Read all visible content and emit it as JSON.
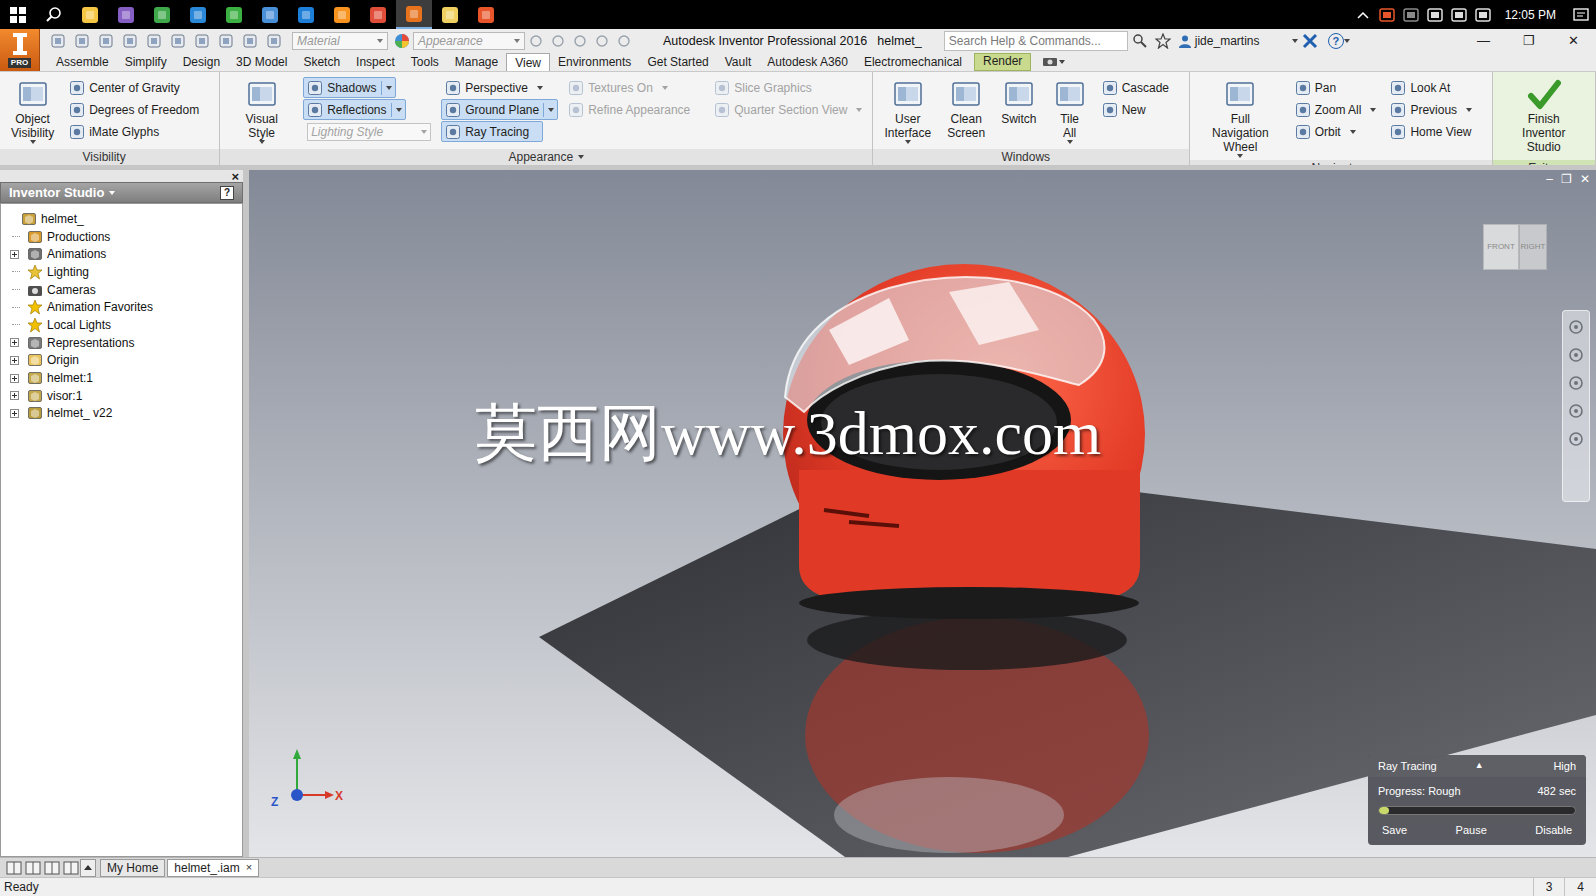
{
  "taskbar": {
    "time": "12:05 PM"
  },
  "app_menu": {
    "label": "PRO"
  },
  "title_bar": {
    "material": "Material",
    "appearance": "Appearance",
    "title": "Autodesk Inventor Professional 2016",
    "document": "helmet_",
    "search_placeholder": "Search Help & Commands...",
    "user": "jide_martins",
    "help": "?",
    "controls": [
      "—",
      "❐",
      "✕"
    ]
  },
  "menu_tabs": [
    {
      "label": "Assemble",
      "selected": false,
      "kind": "normal"
    },
    {
      "label": "Simplify",
      "selected": false,
      "kind": "normal"
    },
    {
      "label": "Design",
      "selected": false,
      "kind": "normal"
    },
    {
      "label": "3D Model",
      "selected": false,
      "kind": "normal"
    },
    {
      "label": "Sketch",
      "selected": false,
      "kind": "normal"
    },
    {
      "label": "Inspect",
      "selected": false,
      "kind": "normal"
    },
    {
      "label": "Tools",
      "selected": false,
      "kind": "normal"
    },
    {
      "label": "Manage",
      "selected": false,
      "kind": "normal"
    },
    {
      "label": "View",
      "selected": true,
      "kind": "normal"
    },
    {
      "label": "Environments",
      "selected": false,
      "kind": "normal"
    },
    {
      "label": "Get Started",
      "selected": false,
      "kind": "normal"
    },
    {
      "label": "Vault",
      "selected": false,
      "kind": "normal"
    },
    {
      "label": "Autodesk A360",
      "selected": false,
      "kind": "normal"
    },
    {
      "label": "Electromechanical",
      "selected": false,
      "kind": "normal"
    },
    {
      "label": "Render",
      "selected": false,
      "kind": "contextual"
    }
  ],
  "ribbon": {
    "panels": [
      {
        "title": "Visibility",
        "has_menu": false,
        "columns": [
          [
            {
              "label": "Object\nVisibility",
              "kind": "large",
              "has_menu": true,
              "on": false,
              "disabled": false
            }
          ],
          [
            {
              "label": "Center of Gravity",
              "kind": "small",
              "has_menu": false,
              "on": false,
              "disabled": false
            },
            {
              "label": "Degrees of Freedom",
              "kind": "small",
              "has_menu": false,
              "on": false,
              "disabled": false
            },
            {
              "label": "iMate Glyphs",
              "kind": "small",
              "has_menu": false,
              "on": false,
              "disabled": false
            }
          ]
        ]
      },
      {
        "title": "Appearance",
        "has_menu": true,
        "columns": [
          [
            {
              "label": "Visual Style",
              "kind": "large",
              "has_menu": true,
              "on": false,
              "disabled": false
            }
          ],
          [
            {
              "label": "Shadows",
              "kind": "small",
              "has_menu": true,
              "on": true,
              "disabled": false
            },
            {
              "label": "Reflections",
              "kind": "small",
              "has_menu": true,
              "on": true,
              "disabled": false
            },
            {
              "label": "Lighting Style",
              "kind": "combo",
              "has_menu": true,
              "on": false,
              "disabled": true
            }
          ],
          [
            {
              "label": "Perspective",
              "kind": "small",
              "has_menu": true,
              "on": false,
              "disabled": false
            },
            {
              "label": "Ground Plane",
              "kind": "small",
              "has_menu": true,
              "on": true,
              "disabled": false
            },
            {
              "label": "Ray Tracing",
              "kind": "small",
              "has_menu": false,
              "on": true,
              "disabled": false
            }
          ],
          [
            {
              "label": "Textures On",
              "kind": "small",
              "has_menu": true,
              "on": false,
              "disabled": true
            },
            {
              "label": "Refine Appearance",
              "kind": "small",
              "has_menu": false,
              "on": false,
              "disabled": true
            }
          ],
          [
            {
              "label": "Slice Graphics",
              "kind": "small",
              "has_menu": false,
              "on": false,
              "disabled": true
            },
            {
              "label": "Quarter Section View",
              "kind": "small",
              "has_menu": true,
              "on": false,
              "disabled": true
            }
          ]
        ]
      },
      {
        "title": "Windows",
        "has_menu": false,
        "columns": [
          [
            {
              "label": "User\nInterface",
              "kind": "large",
              "has_menu": true,
              "on": false,
              "disabled": false
            }
          ],
          [
            {
              "label": "Clean\nScreen",
              "kind": "large",
              "has_menu": false,
              "on": false,
              "disabled": false
            }
          ],
          [
            {
              "label": "Switch",
              "kind": "large",
              "has_menu": false,
              "on": false,
              "disabled": false
            }
          ],
          [
            {
              "label": "Tile All",
              "kind": "large",
              "has_menu": true,
              "on": false,
              "disabled": false
            }
          ],
          [
            {
              "label": "Cascade",
              "kind": "small",
              "has_menu": false,
              "on": false,
              "disabled": false
            },
            {
              "label": "New",
              "kind": "small",
              "has_menu": false,
              "on": false,
              "disabled": false
            }
          ]
        ]
      },
      {
        "title": "Navigate",
        "has_menu": false,
        "columns": [
          [
            {
              "label": "Full Navigation\nWheel",
              "kind": "large",
              "has_menu": true,
              "on": false,
              "disabled": false
            }
          ],
          [
            {
              "label": "Pan",
              "kind": "small",
              "has_menu": false,
              "on": false,
              "disabled": false
            },
            {
              "label": "Zoom All",
              "kind": "small",
              "has_menu": true,
              "on": false,
              "disabled": false
            },
            {
              "label": "Orbit",
              "kind": "small",
              "has_menu": true,
              "on": false,
              "disabled": false
            }
          ],
          [
            {
              "label": "Look At",
              "kind": "small",
              "has_menu": false,
              "on": false,
              "disabled": false
            },
            {
              "label": "Previous",
              "kind": "small",
              "has_menu": true,
              "on": false,
              "disabled": false
            },
            {
              "label": "Home View",
              "kind": "small",
              "has_menu": false,
              "on": false,
              "disabled": false
            }
          ]
        ]
      },
      {
        "title": "Exit",
        "has_menu": false,
        "columns": [
          [
            {
              "label": "Finish\nInventor Studio",
              "kind": "finish",
              "has_menu": false,
              "on": false,
              "disabled": false
            }
          ]
        ]
      }
    ]
  },
  "browser": {
    "close": "×",
    "title": "Inventor Studio",
    "help": "?",
    "items": [
      {
        "label": "helmet_",
        "kind": "assembly",
        "depth": 0,
        "expandable": false,
        "expanded": true
      },
      {
        "label": "Productions",
        "kind": "production",
        "depth": 1,
        "expandable": false,
        "expanded": false
      },
      {
        "label": "Animations",
        "kind": "animation",
        "depth": 1,
        "expandable": true,
        "expanded": false
      },
      {
        "label": "Lighting",
        "kind": "lighting",
        "depth": 1,
        "expandable": false,
        "expanded": false
      },
      {
        "label": "Cameras",
        "kind": "camera",
        "depth": 1,
        "expandable": false,
        "expanded": false
      },
      {
        "label": "Animation Favorites",
        "kind": "favorite",
        "depth": 1,
        "expandable": false,
        "expanded": false
      },
      {
        "label": "Local Lights",
        "kind": "light",
        "depth": 1,
        "expandable": false,
        "expanded": false
      },
      {
        "label": "Representations",
        "kind": "representation",
        "depth": 1,
        "expandable": true,
        "expanded": false
      },
      {
        "label": "Origin",
        "kind": "folder",
        "depth": 1,
        "expandable": true,
        "expanded": false
      },
      {
        "label": "helmet:1",
        "kind": "part",
        "depth": 1,
        "expandable": true,
        "expanded": false
      },
      {
        "label": "visor:1",
        "kind": "part",
        "depth": 1,
        "expandable": true,
        "expanded": false
      },
      {
        "label": "helmet_ v22",
        "kind": "derived",
        "depth": 1,
        "expandable": true,
        "expanded": false
      }
    ]
  },
  "viewport": {
    "watermark": "莫西网www.3dmox.com",
    "view_cube": {
      "front": "FRONT",
      "right": "RIGHT"
    },
    "axes": {
      "z": "Z",
      "x": "X"
    },
    "controls": [
      "–",
      "❐",
      "✕"
    ]
  },
  "ray_tracing": {
    "title": "Ray Tracing",
    "arrow": "▲",
    "quality": "High",
    "progress_label": "Progress: Rough",
    "time": "482 sec",
    "level": 0.05,
    "buttons": [
      "Save",
      "Pause",
      "Disable"
    ]
  },
  "document_tabs": [
    {
      "label": "My Home",
      "selected": false
    },
    {
      "label": "helmet_.iam",
      "selected": true,
      "close": "×"
    }
  ],
  "status_bar": {
    "message": "Ready",
    "values": [
      "3",
      "4"
    ]
  }
}
